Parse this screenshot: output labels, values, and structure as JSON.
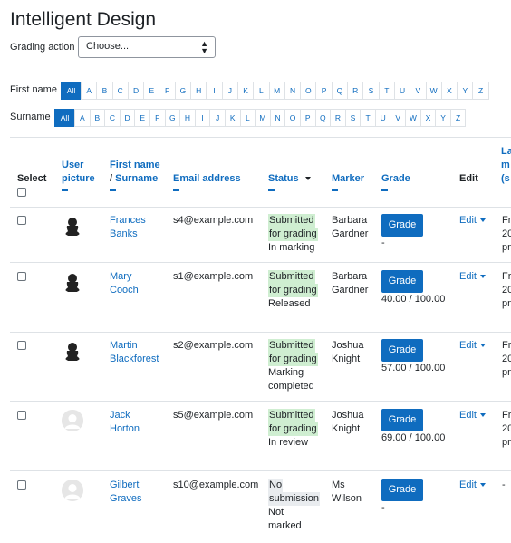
{
  "page": {
    "title": "Intelligent Design"
  },
  "grading_action": {
    "label": "Grading action",
    "value": "Choose..."
  },
  "first_name_filter": {
    "label": "First name",
    "letters": [
      "All",
      "A",
      "B",
      "C",
      "D",
      "E",
      "F",
      "G",
      "H",
      "I",
      "J",
      "K",
      "L",
      "M",
      "N",
      "O",
      "P",
      "Q",
      "R",
      "S",
      "T",
      "U",
      "V",
      "W",
      "X",
      "Y",
      "Z"
    ],
    "active": "All"
  },
  "surname_filter": {
    "label": "Surname",
    "letters": [
      "All",
      "A",
      "B",
      "C",
      "D",
      "E",
      "F",
      "G",
      "H",
      "I",
      "J",
      "K",
      "L",
      "M",
      "N",
      "O",
      "P",
      "Q",
      "R",
      "S",
      "T",
      "U",
      "V",
      "W",
      "X",
      "Y",
      "Z"
    ],
    "active": "All"
  },
  "table": {
    "headers": {
      "select": "Select",
      "user_picture_1": "User",
      "user_picture_2": "picture",
      "first_name": "First name",
      "slash": "/",
      "surname": "Surname",
      "email": "Email address",
      "status": "Status",
      "marker": "Marker",
      "grade": "Grade",
      "edit": "Edit",
      "last_1": "La",
      "last_2": "m",
      "last_3": "(s"
    },
    "rows": [
      {
        "avatar": "dark",
        "first": "Frances",
        "last": "Banks",
        "email": "s4@example.com",
        "status_main_1": "Submitted",
        "status_main_2": "for grading",
        "status_main_style": "green",
        "status_extra": [
          "In marking"
        ],
        "marker_1": "Barbara",
        "marker_2": "Gardner",
        "grade_button": "Grade",
        "grade_value": "-",
        "edit": "Edit",
        "last_1": "Fr",
        "last_2": "20",
        "last_3": "pm"
      },
      {
        "avatar": "dark",
        "first": "Mary",
        "last": "Cooch",
        "email": "s1@example.com",
        "status_main_1": "Submitted",
        "status_main_2": "for grading",
        "status_main_style": "green",
        "status_extra": [
          "Released"
        ],
        "marker_1": "Barbara",
        "marker_2": "Gardner",
        "grade_button": "Grade",
        "grade_value": "40.00 / 100.00",
        "edit": "Edit",
        "last_1": "Fr",
        "last_2": "20",
        "last_3": "pm"
      },
      {
        "avatar": "dark",
        "first": "Martin",
        "last": "Blackforest",
        "email": "s2@example.com",
        "status_main_1": "Submitted",
        "status_main_2": "for grading",
        "status_main_style": "green",
        "status_extra": [
          "Marking",
          "completed"
        ],
        "marker_1": "Joshua",
        "marker_2": "Knight",
        "grade_button": "Grade",
        "grade_value": "57.00 / 100.00",
        "edit": "Edit",
        "last_1": "Fr",
        "last_2": "20",
        "last_3": "pm"
      },
      {
        "avatar": "light",
        "first": "Jack",
        "last": "Horton",
        "email": "s5@example.com",
        "status_main_1": "Submitted",
        "status_main_2": "for grading",
        "status_main_style": "green",
        "status_extra": [
          "In review"
        ],
        "marker_1": "Joshua",
        "marker_2": "Knight",
        "grade_button": "Grade",
        "grade_value": "69.00 / 100.00",
        "edit": "Edit",
        "last_1": "Fr",
        "last_2": "20",
        "last_3": "pm"
      },
      {
        "avatar": "light",
        "first": "Gilbert",
        "last": "Graves",
        "email": "s10@example.com",
        "status_main_1": "No",
        "status_main_2": "submission",
        "status_main_style": "grey",
        "status_extra": [
          "Not",
          "marked"
        ],
        "marker_1": "Ms",
        "marker_2": "Wilson",
        "grade_button": "Grade",
        "grade_value": "-",
        "edit": "Edit",
        "last_1": "-",
        "last_2": "",
        "last_3": ""
      }
    ]
  },
  "colors": {
    "link": "#0f6cbf",
    "submitted_bg": "#cfeed1",
    "nosub_bg": "#e9ecef",
    "border": "#dee2e6"
  }
}
